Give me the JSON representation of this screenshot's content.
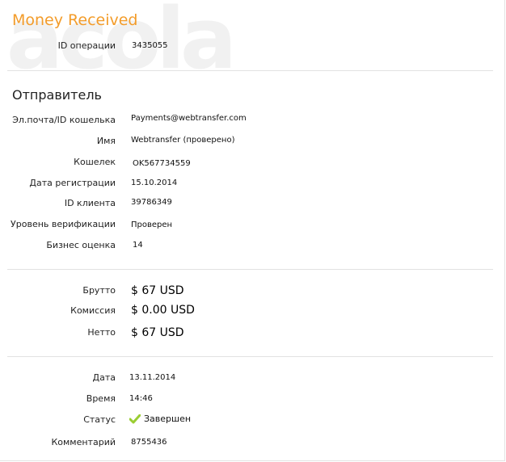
{
  "header": {
    "title": "Money Received",
    "watermark": "acola",
    "operation_id_label": "ID операции",
    "operation_id": "3435055"
  },
  "sender": {
    "title": "Отправитель",
    "rows": [
      {
        "label": "Эл.почта/ID кошелька",
        "value": "Payments@webtransfer.com"
      },
      {
        "label": "Имя",
        "value": "Webtransfer (проверено)"
      },
      {
        "label": "Кошелек",
        "value": "OK567734559"
      },
      {
        "label": "Дата регистрации",
        "value": "15.10.2014"
      },
      {
        "label": "ID клиента",
        "value": "39786349"
      },
      {
        "label": "Уровень верификации",
        "value": "Проверен"
      },
      {
        "label": "Бизнес оценка",
        "value": "14"
      }
    ]
  },
  "amounts": {
    "gross_label": "Брутто",
    "gross": "$ 67 USD",
    "fee_label": "Комиссия",
    "fee": "$ 0.00 USD",
    "net_label": "Нетто",
    "net": "$ 67 USD"
  },
  "details": {
    "date_label": "Дата",
    "date": "13.11.2014",
    "time_label": "Время",
    "time": "14:46",
    "status_label": "Статус",
    "status": "Завершен",
    "status_icon": "check-icon",
    "comment_label": "Комментарий",
    "comment": "8755436"
  },
  "colors": {
    "title": "#f39c2a",
    "check": "#9acd32"
  }
}
